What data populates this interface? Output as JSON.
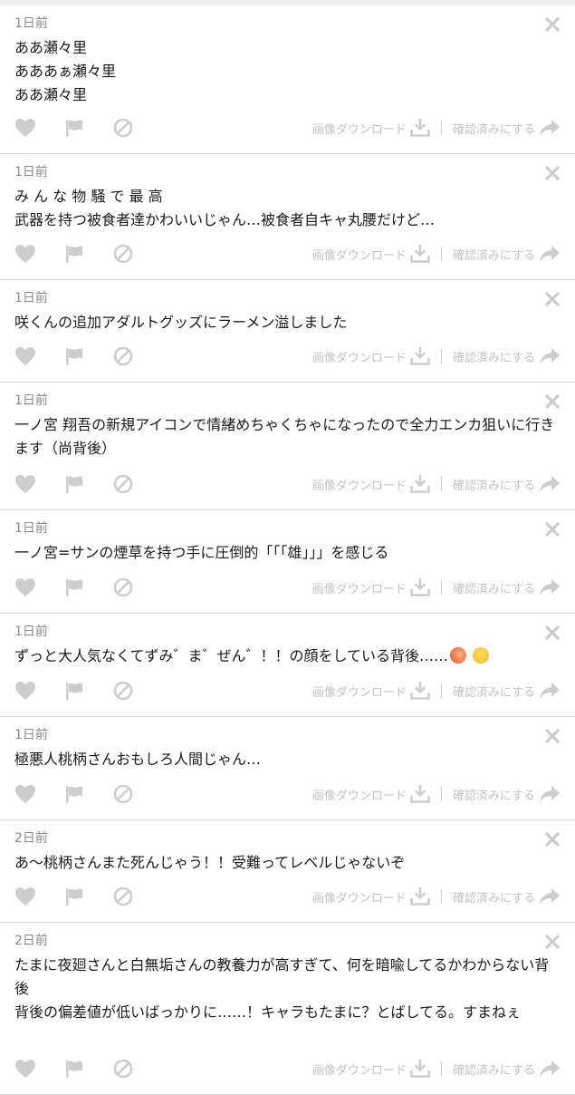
{
  "actions": {
    "download_label": "画像ダウンロード",
    "confirm_label": "確認済みにする"
  },
  "posts": [
    {
      "time": "1日前",
      "text": "ああ瀬々里\nあああぁ瀬々里\nああ瀬々里",
      "height": 164
    },
    {
      "time": "1日前",
      "text": "み ん な 物 騒 で 最 高\n武器を持つ被食者達かわいいじゃん…被食者自キャ丸腰だけど…",
      "height": 139
    },
    {
      "time": "1日前",
      "text": "咲くんの追加アダルトグッズにラーメン溢しました",
      "height": 113
    },
    {
      "time": "1日前",
      "text": "一ノ宮 翔吾の新規アイコンで情緒めちゃくちゃになったので全力エンカ狙いに行きます（尚背後）",
      "height": 141
    },
    {
      "time": "1日前",
      "text": "一ノ宮=サンの煙草を持つ手に圧倒的「「「雄」」」を感じる",
      "height": 114
    },
    {
      "time": "1日前",
      "text": "ずっと大人気なくてずみ゛ま゛ぜん゛！！の顔をしている背後……",
      "height": 114
    },
    {
      "time": "1日前",
      "text": "極悪人桃柄さんおもしろ人間じゃん…",
      "height": 114
    },
    {
      "time": "2日前",
      "text": "あ〜桃柄さんまた死んじゃう！！受難ってレベルじゃないぞ",
      "height": 113
    },
    {
      "time": "2日前",
      "text": "たまに夜廻さんと白無垢さんの教養力が高すぎて、何を暗喩してるかわからない背後\n背後の偏差値が低いばっかりに……！キャラもたまに？とばしてる。すまねぇ",
      "height": 190
    }
  ],
  "colors": {
    "icon": "#cdcdd0",
    "text": "#1a1a1a",
    "meta": "#8a8a8f"
  }
}
